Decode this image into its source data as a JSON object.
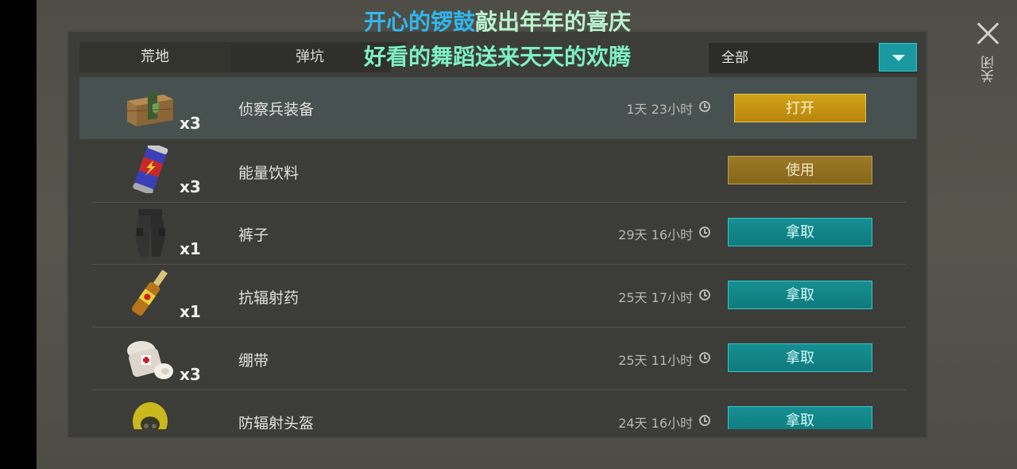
{
  "tabs": [
    {
      "label": "荒地"
    },
    {
      "label": "弹坑"
    }
  ],
  "filter": {
    "label": "全部"
  },
  "close": {
    "label": "关闭"
  },
  "subtitle": {
    "line1_a": "开心的锣鼓",
    "line1_b": "敲出年年的喜庆",
    "line2": "好看的舞蹈送来天天的欢腾"
  },
  "items": [
    {
      "name": "侦察兵装备",
      "count": "x3",
      "time": "1天 23小时",
      "action": "打开",
      "icon": "crate-icon"
    },
    {
      "name": "能量饮料",
      "count": "x3",
      "time": "",
      "action": "使用",
      "icon": "energy-drink-icon"
    },
    {
      "name": "裤子",
      "count": "x1",
      "time": "29天 16小时",
      "action": "拿取",
      "icon": "pants-icon"
    },
    {
      "name": "抗辐射药",
      "count": "x1",
      "time": "25天 17小时",
      "action": "拿取",
      "icon": "ampoule-icon"
    },
    {
      "name": "绷带",
      "count": "x3",
      "time": "25天 11小时",
      "action": "拿取",
      "icon": "bandage-icon"
    },
    {
      "name": "防辐射头盔",
      "count": "",
      "time": "24天 16小时",
      "action": "拿取",
      "icon": "hazmat-helmet-icon"
    }
  ]
}
